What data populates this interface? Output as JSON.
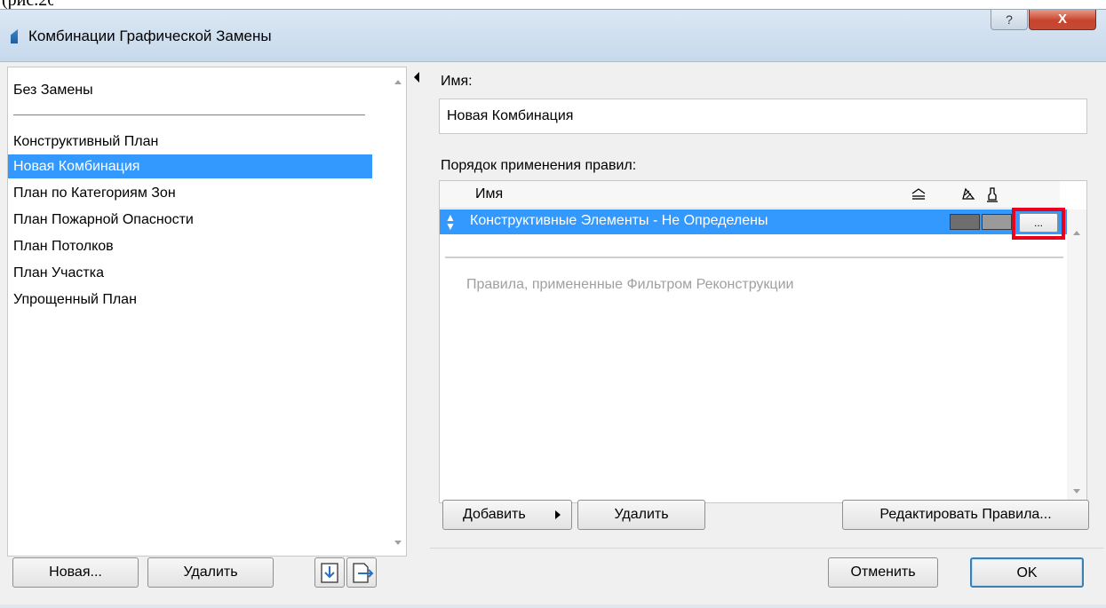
{
  "window": {
    "title": "Комбинации Графической Замены",
    "help_label": "?",
    "close_label": "X"
  },
  "list": {
    "items": [
      "Без Замены",
      "Конструктивный План",
      "Новая Комбинация",
      "План по Категориям Зон",
      "План Пожарной Опасности",
      "План Потолков",
      "План Участка",
      "Упрощенный План"
    ],
    "selected_index": 2
  },
  "left_buttons": {
    "new_label": "Новая...",
    "delete_label": "Удалить"
  },
  "form": {
    "name_label": "Имя:",
    "name_value": "Новая Комбинация",
    "rules_label": "Порядок применения правил:"
  },
  "rules_table": {
    "header_name": "Имя",
    "rows": [
      {
        "name": "Конструктивные Элементы - Не Определены",
        "dots_label": "..."
      }
    ],
    "renovation_note": "Правила, примененные Фильтром Реконструкции"
  },
  "rule_buttons": {
    "add_label": "Добавить",
    "delete_label": "Удалить",
    "edit_label": "Редактировать Правила..."
  },
  "footer": {
    "cancel_label": "Отменить",
    "ok_label": "OK"
  },
  "colors": {
    "selection": "#3399ff",
    "highlight_box": "#e8001c",
    "swatch_dark": "#6e6e6e",
    "swatch_light": "#9a9a9a"
  },
  "icons": [
    "area-icon",
    "fill-icon",
    "pen-icon",
    "import-icon",
    "export-icon",
    "reorder-grip-icon"
  ]
}
